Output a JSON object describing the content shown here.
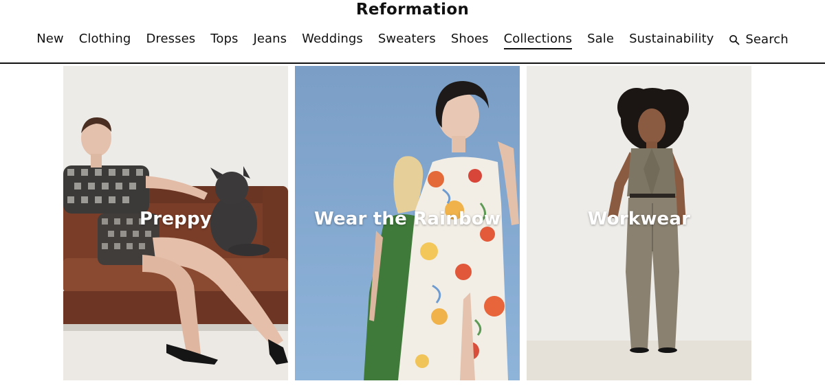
{
  "brand": {
    "name": "Reformation"
  },
  "nav": {
    "items": [
      {
        "label": "New"
      },
      {
        "label": "Clothing"
      },
      {
        "label": "Dresses"
      },
      {
        "label": "Tops"
      },
      {
        "label": "Jeans"
      },
      {
        "label": "Weddings"
      },
      {
        "label": "Sweaters"
      },
      {
        "label": "Shoes"
      },
      {
        "label": "Collections",
        "active": true
      },
      {
        "label": "Sale"
      },
      {
        "label": "Sustainability"
      }
    ],
    "search_label": "Search",
    "search_icon": "search-icon"
  },
  "collections": [
    {
      "label": "Preppy",
      "image": "woman-in-gingham-set-on-leather-sofa-with-french-bulldog"
    },
    {
      "label": "Wear the Rainbow",
      "image": "two-women-in-green-and-floral-dresses-against-blue-sky"
    },
    {
      "label": "Workwear",
      "image": "woman-in-taupe-vest-and-trousers-studio"
    }
  ],
  "colors": {
    "accent": "#111111",
    "background": "#ffffff",
    "tile_text": "#ffffff"
  }
}
